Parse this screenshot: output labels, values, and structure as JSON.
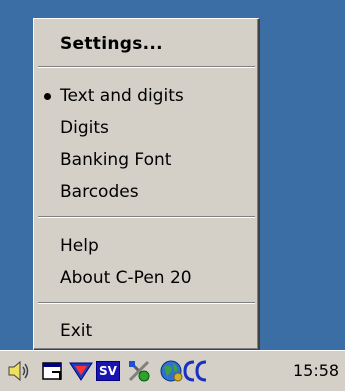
{
  "menu": {
    "settings_label": "Settings...",
    "items": [
      {
        "label": "Text and digits",
        "selected": true
      },
      {
        "label": "Digits",
        "selected": false
      },
      {
        "label": "Banking Font",
        "selected": false
      },
      {
        "label": "Barcodes",
        "selected": false
      }
    ],
    "help_label": "Help",
    "about_label": "About C-Pen 20",
    "exit_label": "Exit"
  },
  "taskbar": {
    "tray_icons": [
      "speaker-icon",
      "window-icon",
      "network-icon",
      "sv-language-icon",
      "tools-icon",
      "globe-icon",
      "cpen-icon"
    ],
    "language_code": "SV",
    "clock": "15:58"
  },
  "colors": {
    "desktop": "#3a6ea5",
    "menu_face": "#d4d0c8",
    "sv_badge": "#1a14b0"
  }
}
